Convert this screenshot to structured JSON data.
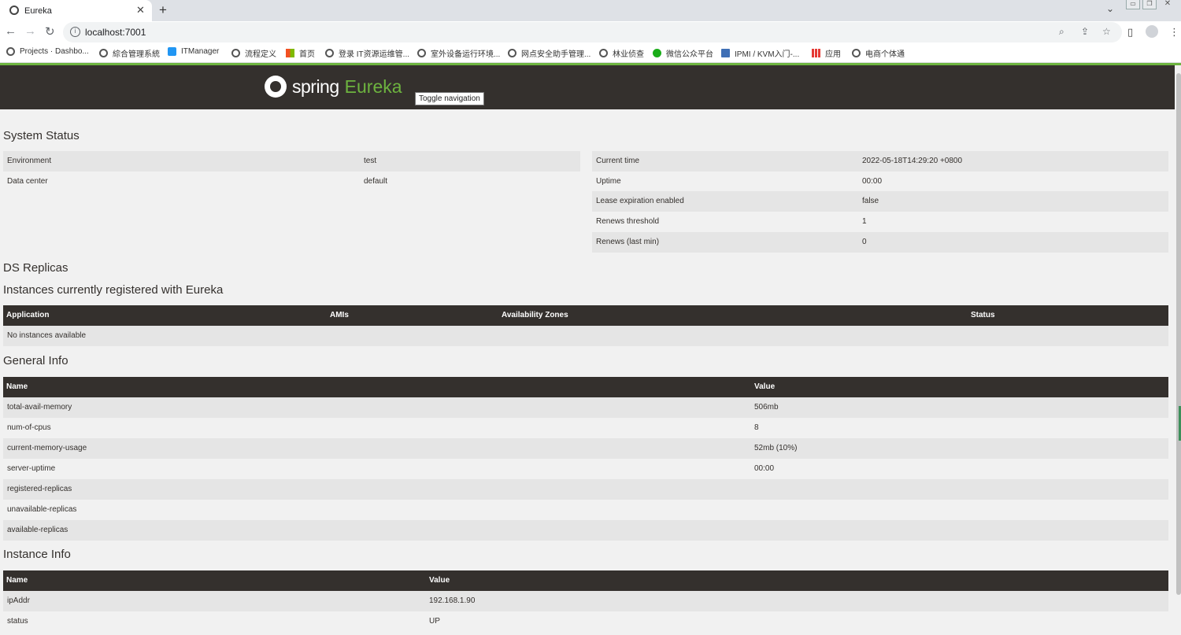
{
  "browser": {
    "tab_title": "Eureka",
    "url": "localhost:7001",
    "bookmarks": [
      "Projects · Dashbo...",
      "綜合管理系統",
      "ITManager",
      "流程定义",
      "首页",
      "登录 IT资源运维管...",
      "室外设备运行环境...",
      "网点安全助手管理...",
      "林业侦查",
      "微信公众平台",
      "IPMI / KVM入门-...",
      "应用",
      "电商个体通"
    ]
  },
  "navbar": {
    "brand_spring": "spring",
    "brand_eureka": "Eureka",
    "toggle_label": "Toggle navigation"
  },
  "system_status": {
    "title": "System Status",
    "left": [
      {
        "name": "Environment",
        "value": "test"
      },
      {
        "name": "Data center",
        "value": "default"
      }
    ],
    "right": [
      {
        "name": "Current time",
        "value": "2022-05-18T14:29:20 +0800"
      },
      {
        "name": "Uptime",
        "value": "00:00"
      },
      {
        "name": "Lease expiration enabled",
        "value": "false"
      },
      {
        "name": "Renews threshold",
        "value": "1"
      },
      {
        "name": "Renews (last min)",
        "value": "0"
      }
    ]
  },
  "ds_replicas": {
    "title": "DS Replicas"
  },
  "instances": {
    "title": "Instances currently registered with Eureka",
    "headers": [
      "Application",
      "AMIs",
      "Availability Zones",
      "Status"
    ],
    "empty_message": "No instances available"
  },
  "general_info": {
    "title": "General Info",
    "headers": [
      "Name",
      "Value"
    ],
    "rows": [
      {
        "name": "total-avail-memory",
        "value": "506mb"
      },
      {
        "name": "num-of-cpus",
        "value": "8"
      },
      {
        "name": "current-memory-usage",
        "value": "52mb (10%)"
      },
      {
        "name": "server-uptime",
        "value": "00:00"
      },
      {
        "name": "registered-replicas",
        "value": ""
      },
      {
        "name": "unavailable-replicas",
        "value": ""
      },
      {
        "name": "available-replicas",
        "value": ""
      }
    ]
  },
  "instance_info": {
    "title": "Instance Info",
    "headers": [
      "Name",
      "Value"
    ],
    "rows": [
      {
        "name": "ipAddr",
        "value": "192.168.1.90"
      },
      {
        "name": "status",
        "value": "UP"
      }
    ]
  }
}
